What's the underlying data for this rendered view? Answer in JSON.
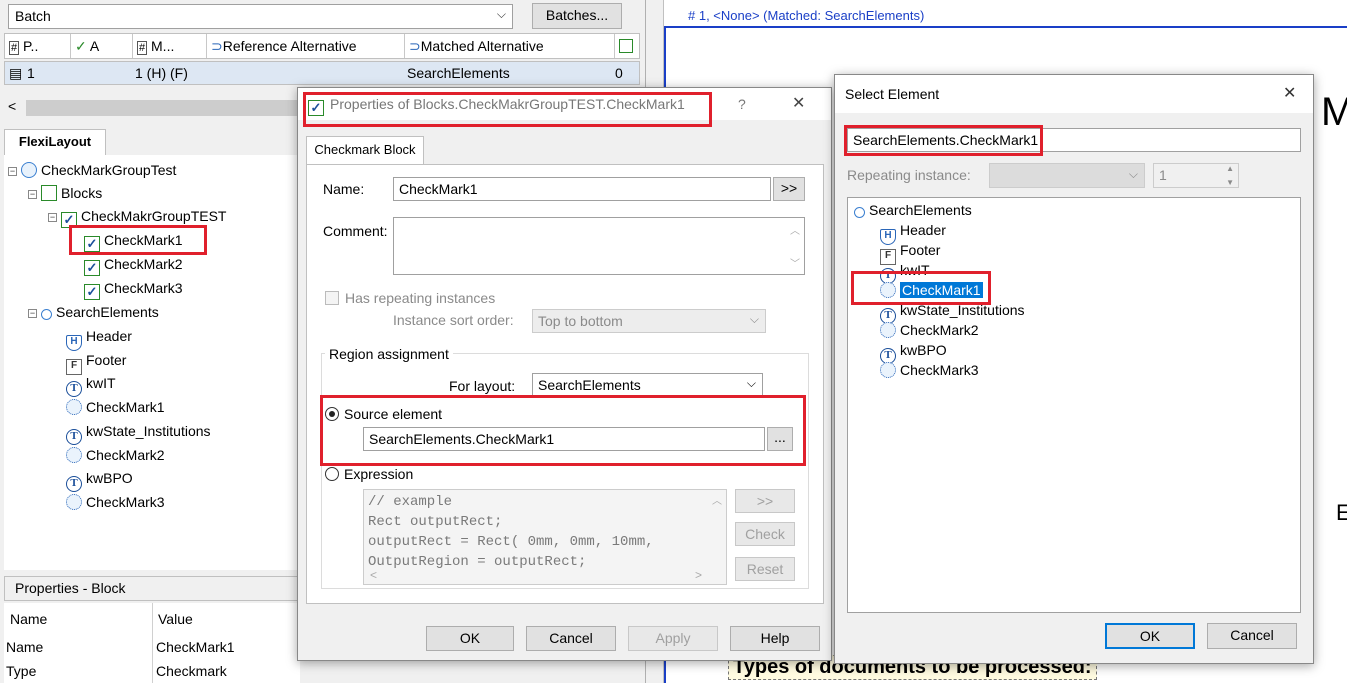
{
  "left": {
    "batch_combo": "Batch",
    "batches_button": "Batches...",
    "grid_headers": [
      "P..",
      "A",
      "M...",
      "Reference Alternative",
      "Matched Alternative"
    ],
    "grid_row": {
      "num": "1",
      "a": "1 (H) (F)",
      "ref": "SearchElements",
      "matched": "0"
    },
    "tab_label": "FlexiLayout",
    "tree": {
      "root": "CheckMarkGroupTest",
      "blocks": "Blocks",
      "group": "CheckMakrGroupTEST",
      "cm1": "CheckMark1",
      "cm2": "CheckMark2",
      "cm3": "CheckMark3",
      "search": "SearchElements",
      "items": [
        "Header",
        "Footer",
        "kwIT",
        "CheckMark1",
        "kwState_Institutions",
        "CheckMark2",
        "kwBPO",
        "CheckMark3"
      ]
    },
    "props_title": "Properties - Block",
    "props_headers": {
      "name": "Name",
      "value": "Value"
    },
    "props_rows": [
      {
        "name": "Name",
        "value": "CheckMark1"
      },
      {
        "name": "Type",
        "value": "Checkmark"
      }
    ]
  },
  "right": {
    "header_text": "# 1, <None> (Matched: SearchElements)",
    "doc_bottom_text": "Types of documents to be processed:",
    "doc_fragments": {
      "me": "ME",
      "e": "E"
    }
  },
  "props_dialog": {
    "title": "Properties of Blocks.CheckMakrGroupTEST.CheckMark1",
    "help_glyph": "?",
    "close_glyph": "✕",
    "tab": "Checkmark Block",
    "name_label": "Name:",
    "name_value": "CheckMark1",
    "name_button": ">>",
    "comment_label": "Comment:",
    "has_repeating_label": "Has repeating instances",
    "sort_order_label": "Instance sort order:",
    "sort_order_value": "Top to bottom",
    "region_group_label": "Region assignment",
    "for_layout_label": "For layout:",
    "for_layout_value": "SearchElements",
    "source_element_label": "Source element",
    "source_element_value": "SearchElements.CheckMark1",
    "browse_button": "...",
    "expression_label": "Expression",
    "expression_lines": [
      "// example",
      "Rect outputRect;",
      "outputRect = Rect( 0mm, 0mm, 10mm,",
      "OutputRegion = outputRect;"
    ],
    "expr_buttons": {
      "insert": ">>",
      "check": "Check",
      "reset": "Reset"
    },
    "ok": "OK",
    "cancel": "Cancel",
    "apply": "Apply",
    "help": "Help"
  },
  "select_dialog": {
    "title": "Select Element",
    "close_glyph": "✕",
    "search_value": "SearchElements.CheckMark1",
    "repeating_label": "Repeating instance:",
    "repeating_value": "1",
    "tree_root": "SearchElements",
    "tree_items": [
      "Header",
      "Footer",
      "kwIT",
      "CheckMark1",
      "kwState_Institutions",
      "CheckMark2",
      "kwBPO",
      "CheckMark3"
    ],
    "ok": "OK",
    "cancel": "Cancel"
  },
  "colors": {
    "highlight_red": "#e0202c",
    "selection_blue": "#0078d7",
    "header_blue": "#1a3fc7"
  }
}
